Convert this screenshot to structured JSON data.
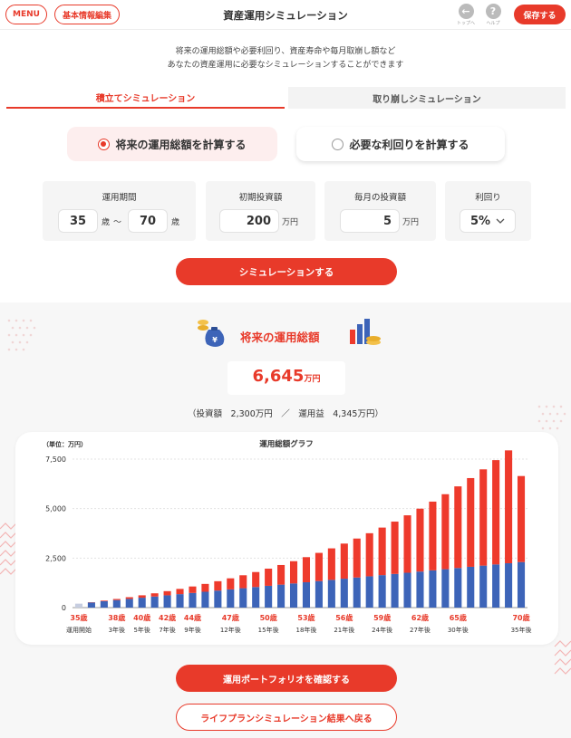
{
  "header": {
    "menu_label": "MENU",
    "basic_info_label": "基本情報編集",
    "title": "資産運用シミュレーション",
    "top_label": "トップへ",
    "help_label": "ヘルプ",
    "save_label": "保存する"
  },
  "intro": {
    "line1": "将来の運用総額や必要利回り、資産寿命や毎月取崩し額など",
    "line2": "あなたの資産運用に必要なシミュレーションすることができます"
  },
  "tabs": [
    {
      "label": "積立てシミュレーション",
      "active": true
    },
    {
      "label": "取り崩しシミュレーション",
      "active": false
    }
  ],
  "modes": [
    {
      "label": "将来の運用総額を計算する",
      "selected": true
    },
    {
      "label": "必要な利回りを計算する",
      "selected": false
    }
  ],
  "params": {
    "period": {
      "label": "運用期間",
      "from": "35",
      "to": "70",
      "unit": "歳",
      "sep": "〜"
    },
    "initial": {
      "label": "初期投資額",
      "value": "200",
      "unit": "万円"
    },
    "monthly": {
      "label": "毎月の投資額",
      "value": "5",
      "unit": "万円"
    },
    "rate": {
      "label": "利回り",
      "value": "5%"
    }
  },
  "simulate_label": "シミュレーションする",
  "result": {
    "title": "将来の運用総額",
    "total": "6,645",
    "total_unit": "万円",
    "breakdown": "（投資額　2,300万円　／　運用益　4,345万円）"
  },
  "colors": {
    "accent": "#e83a2a",
    "principal": "#3d64b8",
    "gain": "#ee3a2c",
    "tab_inactive": "#f3f3f3"
  },
  "chart_data": {
    "type": "bar",
    "stacked": true,
    "title": "運用総額グラフ",
    "unit_label": "（単位：万円）",
    "ylim": [
      0,
      7500
    ],
    "yticks": [
      "0",
      "2,500",
      "5,000",
      "7,500"
    ],
    "ytick_values": [
      0,
      2500,
      5000,
      7500
    ],
    "ages": [
      35,
      36,
      37,
      38,
      39,
      40,
      41,
      42,
      43,
      44,
      45,
      46,
      47,
      48,
      49,
      50,
      51,
      52,
      53,
      54,
      55,
      56,
      57,
      58,
      59,
      60,
      61,
      62,
      63,
      64,
      65,
      66,
      67,
      68,
      69,
      70
    ],
    "series": [
      {
        "name": "投資額",
        "color": "#3d64b8",
        "values": [
          200,
          260,
          320,
          380,
          440,
          500,
          560,
          620,
          680,
          740,
          800,
          860,
          920,
          980,
          1040,
          1100,
          1160,
          1220,
          1280,
          1340,
          1400,
          1460,
          1520,
          1580,
          1640,
          1700,
          1760,
          1820,
          1880,
          1940,
          2000,
          2060,
          2120,
          2180,
          2240,
          2300
        ]
      },
      {
        "name": "運用益",
        "color": "#ee3a2c",
        "values": [
          0,
          13,
          32,
          56,
          86,
          121,
          162,
          211,
          265,
          327,
          396,
          473,
          559,
          653,
          756,
          868,
          991,
          1124,
          1268,
          1424,
          1592,
          1773,
          1968,
          2177,
          2402,
          2643,
          2901,
          3177,
          3472,
          3787,
          4123,
          4481,
          4863,
          5269,
          5701,
          4345
        ]
      }
    ],
    "x_labels": [
      {
        "age": 35,
        "label": "35歳",
        "sub": "運用開始"
      },
      {
        "age": 38,
        "label": "38歳",
        "sub": "3年後"
      },
      {
        "age": 40,
        "label": "40歳",
        "sub": "5年後"
      },
      {
        "age": 42,
        "label": "42歳",
        "sub": "7年後"
      },
      {
        "age": 44,
        "label": "44歳",
        "sub": "9年後"
      },
      {
        "age": 47,
        "label": "47歳",
        "sub": "12年後"
      },
      {
        "age": 50,
        "label": "50歳",
        "sub": "15年後"
      },
      {
        "age": 53,
        "label": "53歳",
        "sub": "18年後"
      },
      {
        "age": 56,
        "label": "56歳",
        "sub": "21年後"
      },
      {
        "age": 59,
        "label": "59歳",
        "sub": "24年後"
      },
      {
        "age": 62,
        "label": "62歳",
        "sub": "27年後"
      },
      {
        "age": 65,
        "label": "65歳",
        "sub": "30年後"
      },
      {
        "age": 70,
        "label": "70歳",
        "sub": "35年後"
      }
    ]
  },
  "actions": {
    "portfolio_label": "運用ポートフォリオを確認する",
    "back_label": "ライフプランシミュレーション結果へ戻る"
  }
}
